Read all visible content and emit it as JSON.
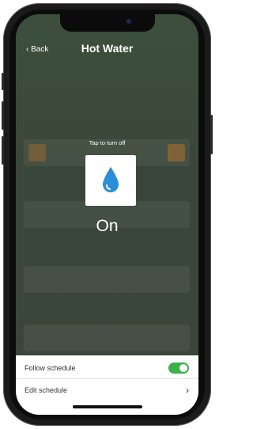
{
  "nav": {
    "back_label": "‹ Back",
    "title": "Hot Water"
  },
  "main": {
    "hint": "Tap to turn off",
    "status": "On",
    "icon": "water-drop-icon",
    "icon_color": "#2a8fd6"
  },
  "schedule": {
    "follow_label": "Follow schedule",
    "follow_enabled": true,
    "edit_label": "Edit schedule",
    "chevron": "›"
  },
  "colors": {
    "toggle_on": "#3db04b",
    "overlay": "#3e473e"
  }
}
